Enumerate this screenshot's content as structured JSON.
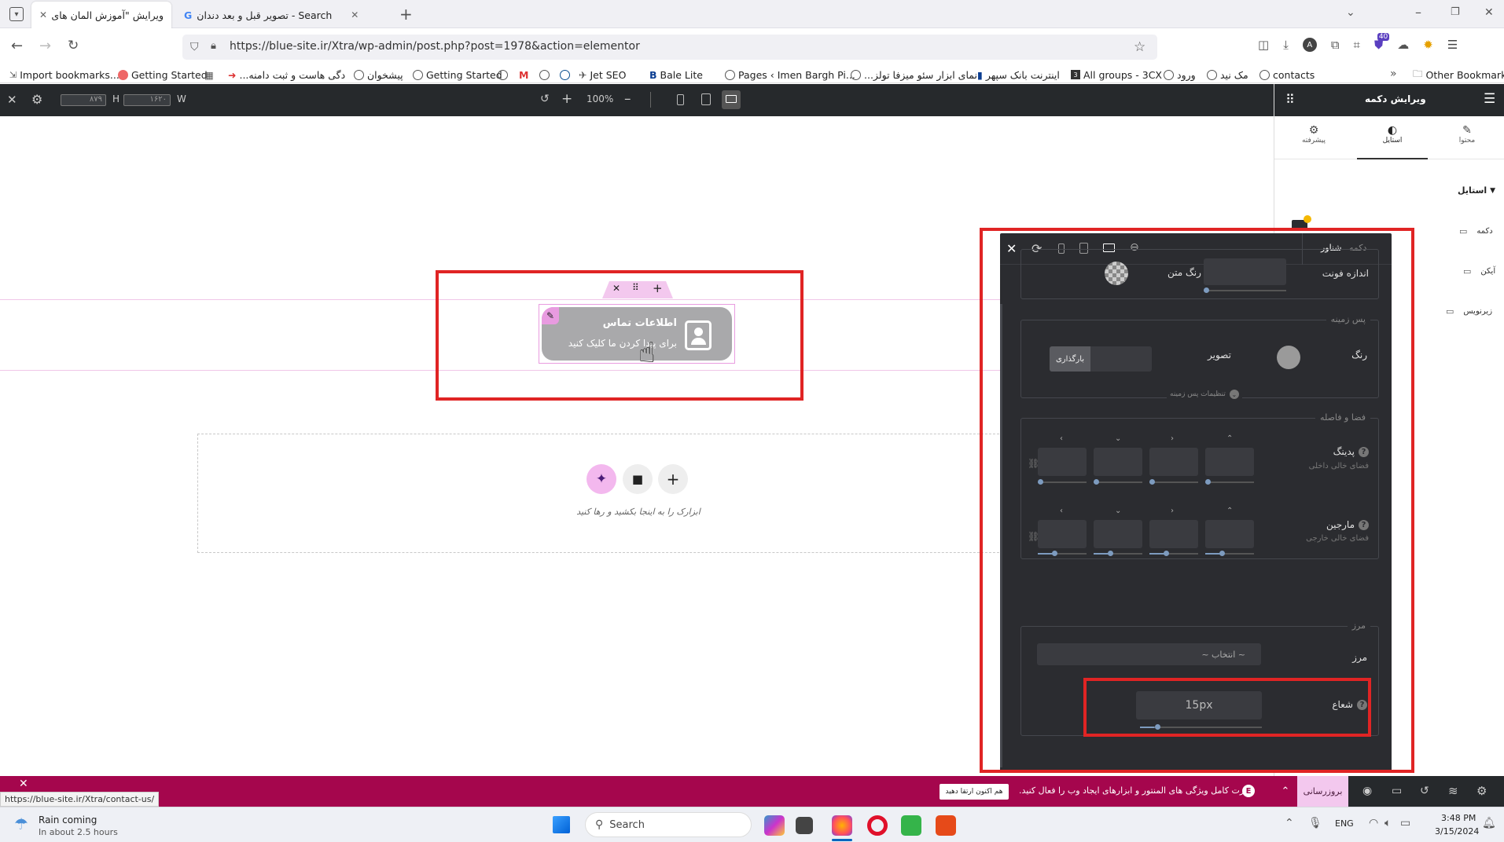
{
  "browser": {
    "tabs": [
      {
        "title": "ویرایش \"آموزش المان های اکسترا -",
        "active": true
      },
      {
        "title": "تصویر قبل و بعد دندان - Search",
        "active": false
      }
    ],
    "url": "https://blue-site.ir/Xtra/wp-admin/post.php?post=1978&action=elementor",
    "extension_badge": "40",
    "bookmarks": [
      "Import bookmarks...",
      "Getting Started",
      "...دگی هاست و ثبت دامنه",
      "پیشخوان",
      "Getting Started",
      "Jet SEO",
      "Bale Lite",
      "Pages ‹ Imen Bargh Pi...",
      "...نمای ابزار سئو میزفا تولز",
      "اینترنت بانک سپهر",
      "All groups - 3CX",
      "ورود",
      "مک نید",
      "contacts"
    ],
    "other_bookmarks": "Other Bookmarks"
  },
  "editor_top": {
    "w_label": "W",
    "w_value": "۱۶۲۰",
    "h_label": "H",
    "h_value": "۸۷۹",
    "zoom": "100%"
  },
  "right_panel": {
    "title": "ویرایش دکمه",
    "tabs": [
      {
        "label": "محتوا",
        "icon": "pencil-icon"
      },
      {
        "label": "استایل",
        "icon": "contrast-icon"
      },
      {
        "label": "پیشرفته",
        "icon": "gear-icon"
      }
    ],
    "style_heading": "استایل",
    "items": [
      "دکمه",
      "آیکن",
      "زیرنویس"
    ]
  },
  "canvas": {
    "widget_title": "اطلاعات تماس",
    "widget_subtitle": "برای پیدا کردن ما کلیک کنید",
    "drop_text": "ابزارک را به اینجا بکشید و رها کنید"
  },
  "floating_panel": {
    "tabs": [
      "دکمه",
      "شناور"
    ],
    "font_size_label": "اندازه فونت",
    "text_color_label": "رنگ متن",
    "background_section": "پس زمینه",
    "color_label": "رنگ",
    "image_label": "تصویر",
    "upload_label": "بارگذاری",
    "bg_settings": "تنظیمات پس زمینه",
    "spacing_section": "فضا و فاصله",
    "padding_label": "پدینگ",
    "padding_sub": "فضای خالی داخلی",
    "margin_label": "مارجین",
    "margin_sub": "فضای خالی خارجی",
    "border_section": "مرز",
    "border_label": "مرز",
    "border_select": "~ انتخاب ~",
    "radius_label": "شعاع",
    "radius_value": "15px"
  },
  "promo_bar": {
    "update_label": "بروزرسانی",
    "message": "قدرت کامل ویژگی های المنتور و ابزارهای ایجاد وب را فعال کنید.",
    "cta": "هم اکنون ارتقا دهید"
  },
  "status_url": "https://blue-site.ir/Xtra/contact-us/",
  "taskbar": {
    "weather_title": "Rain coming",
    "weather_sub": "In about 2.5 hours",
    "search": "Search",
    "lang": "ENG",
    "time": "3:48 PM",
    "date": "3/15/2024"
  }
}
